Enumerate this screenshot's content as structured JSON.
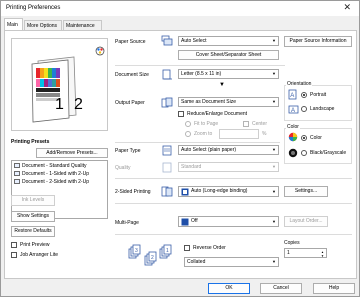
{
  "window": {
    "title": "Printing Preferences",
    "close_glyph": "✕"
  },
  "tabs": [
    {
      "label": "Main",
      "active": true
    },
    {
      "label": "More Options",
      "active": false
    },
    {
      "label": "Maintenance",
      "active": false
    }
  ],
  "presets": {
    "heading": "Printing Presets",
    "add_remove_label": "Add/Remove Presets...",
    "items": [
      "Document - Standard Quality",
      "Document - 1-Sided with 2-Up",
      "Document - 2-Sided with 2-Up"
    ]
  },
  "left_buttons": {
    "ink_levels": "Ink Levels",
    "show_settings": "Show Settings",
    "restore_defaults": "Restore Defaults"
  },
  "left_checks": {
    "print_preview": "Print Preview",
    "job_arranger": "Job Arranger Lite"
  },
  "paper_source": {
    "label": "Paper Source",
    "value": "Auto Select",
    "cover_button": "Cover Sheet/Separator Sheet",
    "info_button": "Paper Source Information"
  },
  "document_size": {
    "label": "Document Size",
    "value": "Letter (8.5 x 11 in)"
  },
  "orientation": {
    "label": "Orientation",
    "portrait": "Portrait",
    "landscape": "Landscape",
    "selected": "Portrait"
  },
  "output_paper": {
    "label": "Output Paper",
    "value": "Same as Document Size",
    "reduce_enlarge": "Reduce/Enlarge Document",
    "fit_to_page": "Fit to Page",
    "center": "Center",
    "zoom_to": "Zoom to",
    "zoom_unit": "%"
  },
  "color": {
    "label": "Color",
    "color_option": "Color",
    "bw_option": "Black/Grayscale",
    "selected": "Color"
  },
  "paper_type": {
    "label": "Paper Type",
    "value": "Auto Select (plain paper)"
  },
  "quality": {
    "label": "Quality",
    "value": "Standard"
  },
  "two_sided": {
    "label": "2-Sided Printing",
    "value": "Auto (Long-edge binding)",
    "settings_button": "Settings..."
  },
  "multi_page": {
    "label": "Multi-Page",
    "value": "Off",
    "layout_button": "Layout Order..."
  },
  "reverse_order": {
    "label": "Reverse Order"
  },
  "collated": {
    "value": "Collated"
  },
  "copies": {
    "label": "Copies",
    "value": "1"
  },
  "preview": {
    "page_numbers": [
      "1",
      "2"
    ]
  },
  "footer": {
    "ok": "OK",
    "cancel": "Cancel",
    "help": "Help"
  }
}
